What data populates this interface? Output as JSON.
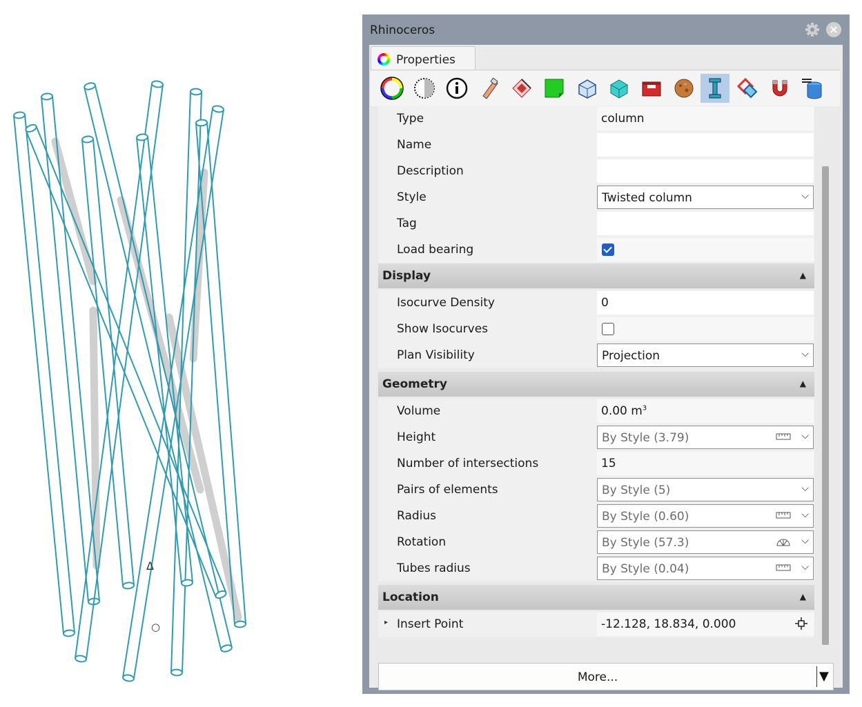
{
  "window": {
    "title": "Rhinoceros"
  },
  "tab": {
    "label": "Properties"
  },
  "toolbar": {
    "icons": [
      "material-color-icon",
      "transparency-icon",
      "info-icon",
      "decal-icon",
      "texture-mapping-icon",
      "layer-icon",
      "shaded-object-icon",
      "mesh-object-icon",
      "bounding-box-icon",
      "rock-material-icon",
      "column-icon",
      "structure-icon",
      "magnet-icon",
      "stacked-cylinder-icon"
    ]
  },
  "properties": {
    "type": {
      "label": "Type",
      "value": "column"
    },
    "name": {
      "label": "Name",
      "value": ""
    },
    "description": {
      "label": "Description",
      "value": ""
    },
    "style": {
      "label": "Style",
      "value": "Twisted column"
    },
    "tag": {
      "label": "Tag",
      "value": ""
    },
    "load_bearing": {
      "label": "Load bearing",
      "checked": true
    }
  },
  "display": {
    "title": "Display",
    "isocurve_density": {
      "label": "Isocurve Density",
      "value": "0"
    },
    "show_isocurves": {
      "label": "Show Isocurves",
      "checked": false
    },
    "plan_visibility": {
      "label": "Plan Visibility",
      "value": "Projection"
    }
  },
  "geometry": {
    "title": "Geometry",
    "volume": {
      "label": "Volume",
      "value": "0.00 m",
      "unit_exp": "3"
    },
    "height": {
      "label": "Height",
      "value": "By Style (3.79)"
    },
    "intersections": {
      "label": "Number of intersections",
      "value": "15"
    },
    "pairs": {
      "label": "Pairs of elements",
      "value": "By Style (5)"
    },
    "radius": {
      "label": "Radius",
      "value": "By Style (0.60)"
    },
    "rotation": {
      "label": "Rotation",
      "value": "By Style (57.3)"
    },
    "tubes_radius": {
      "label": "Tubes radius",
      "value": "By Style (0.04)"
    }
  },
  "location": {
    "title": "Location",
    "insert_point": {
      "label": "Insert Point",
      "value": "-12.128, 18.834, 0.000"
    }
  },
  "more_button": {
    "label": "More..."
  },
  "viewport": {
    "markers": {
      "triangle": "Δ",
      "circle": "○"
    }
  },
  "colors": {
    "tube_stroke": "#2e9bb0",
    "panel_frame": "#8e98a6",
    "section_header": "#c8c8c8",
    "selected_icon": "#b5cde9"
  }
}
